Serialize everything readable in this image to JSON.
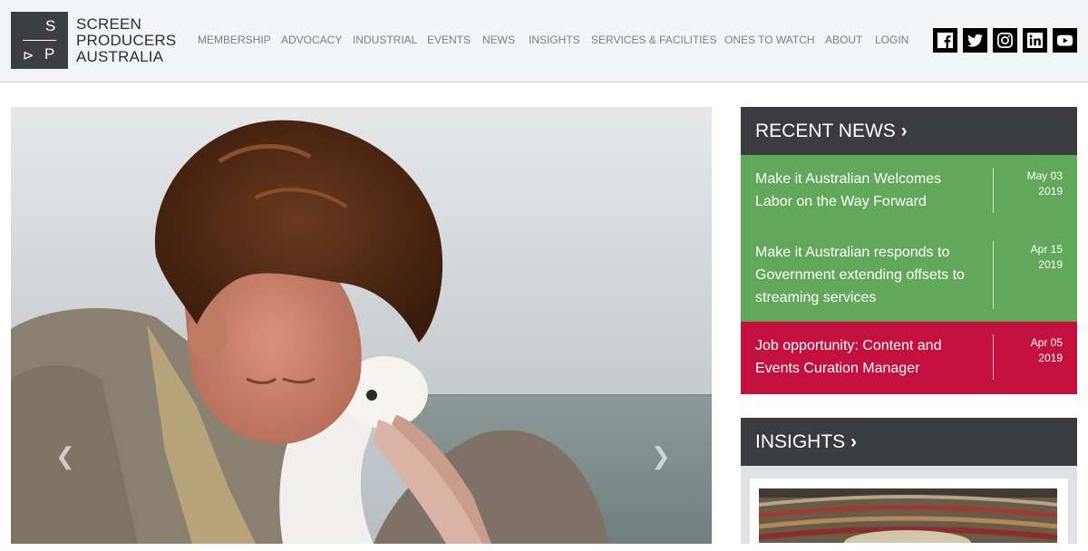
{
  "brand": {
    "logo_letters": [
      "S",
      "⊳",
      "P"
    ],
    "name_lines": [
      "SCREEN",
      "PRODUCERS",
      "AUSTRALIA"
    ]
  },
  "nav": {
    "items": [
      "MEMBERSHIP",
      "ADVOCACY",
      "INDUSTRIAL",
      "EVENTS",
      "NEWS",
      "INSIGHTS",
      "SERVICES & FACILITIES",
      "ONES TO WATCH",
      "ABOUT",
      "LOGIN"
    ]
  },
  "social": [
    "facebook-icon",
    "twitter-icon",
    "instagram-icon",
    "linkedin-icon",
    "youtube-icon"
  ],
  "hero": {
    "prev_arrow": "❮",
    "next_arrow": "❯"
  },
  "recent_news": {
    "heading": "RECENT NEWS",
    "chevron": "›",
    "items": [
      {
        "title": "Make it Australian Welcomes Labor on the Way Forward",
        "date_md": "May 03",
        "date_y": "2019",
        "color": "#62a85a"
      },
      {
        "title": "Make it Australian responds to Government extending offsets to streaming services",
        "date_md": "Apr 15",
        "date_y": "2019",
        "color": "#62a85a"
      },
      {
        "title": "Job opportunity: Content and Events Curation Manager",
        "date_md": "Apr 05",
        "date_y": "2019",
        "color": "#c3103f"
      }
    ]
  },
  "insights": {
    "heading": "INSIGHTS",
    "chevron": "›"
  },
  "colors": {
    "header_bg": "#f3f4f7",
    "panel_head": "#3a3b3f",
    "news_green": "#62a85a",
    "news_red": "#c3103f",
    "insights_bg": "#dfe3e9"
  }
}
